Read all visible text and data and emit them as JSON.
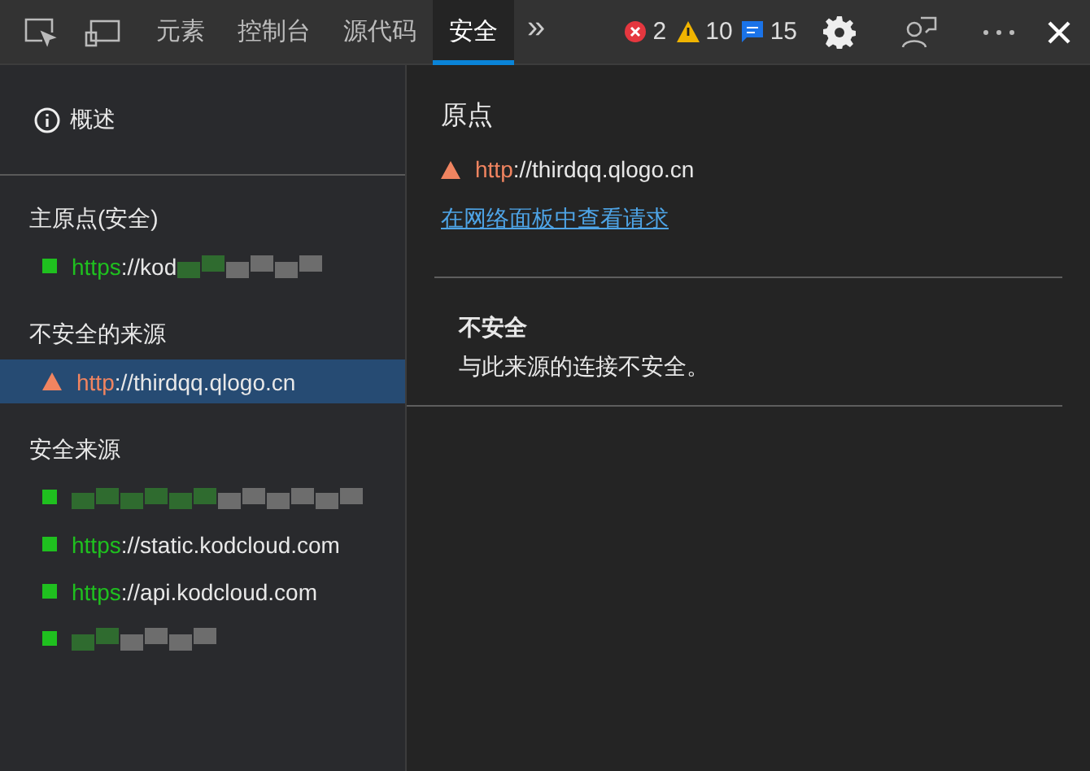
{
  "toolbar": {
    "tabs": [
      {
        "label": "元素",
        "selected": false
      },
      {
        "label": "控制台",
        "selected": false
      },
      {
        "label": "源代码",
        "selected": false
      },
      {
        "label": "安全",
        "selected": true
      }
    ],
    "more": "»",
    "errors": "2",
    "warnings": "10",
    "messages": "15"
  },
  "sidebar": {
    "overview": "概述",
    "sections": [
      {
        "heading": "主原点(安全)",
        "items": [
          {
            "kind": "secure",
            "scheme": "https",
            "rest": "://kod",
            "redacted": true,
            "selected": false
          }
        ]
      },
      {
        "heading": "不安全的来源",
        "items": [
          {
            "kind": "insecure",
            "scheme": "http",
            "rest": "://thirdqq.qlogo.cn",
            "redacted": false,
            "selected": true
          }
        ]
      },
      {
        "heading": "安全来源",
        "items": [
          {
            "kind": "secure",
            "redacted": true,
            "selected": false
          },
          {
            "kind": "secure",
            "scheme": "https",
            "rest": "://static.kodcloud.com",
            "redacted": false,
            "selected": false
          },
          {
            "kind": "secure",
            "scheme": "https",
            "rest": "://api.kodcloud.com",
            "redacted": false,
            "selected": false
          },
          {
            "kind": "secure",
            "redacted": true,
            "selected": false
          }
        ]
      }
    ]
  },
  "main": {
    "title": "原点",
    "origin": {
      "kind": "insecure",
      "scheme": "http",
      "rest": "://thirdqq.qlogo.cn"
    },
    "link": "在网络面板中查看请求",
    "status_title": "不安全",
    "status_text": "与此来源的连接不安全。"
  }
}
